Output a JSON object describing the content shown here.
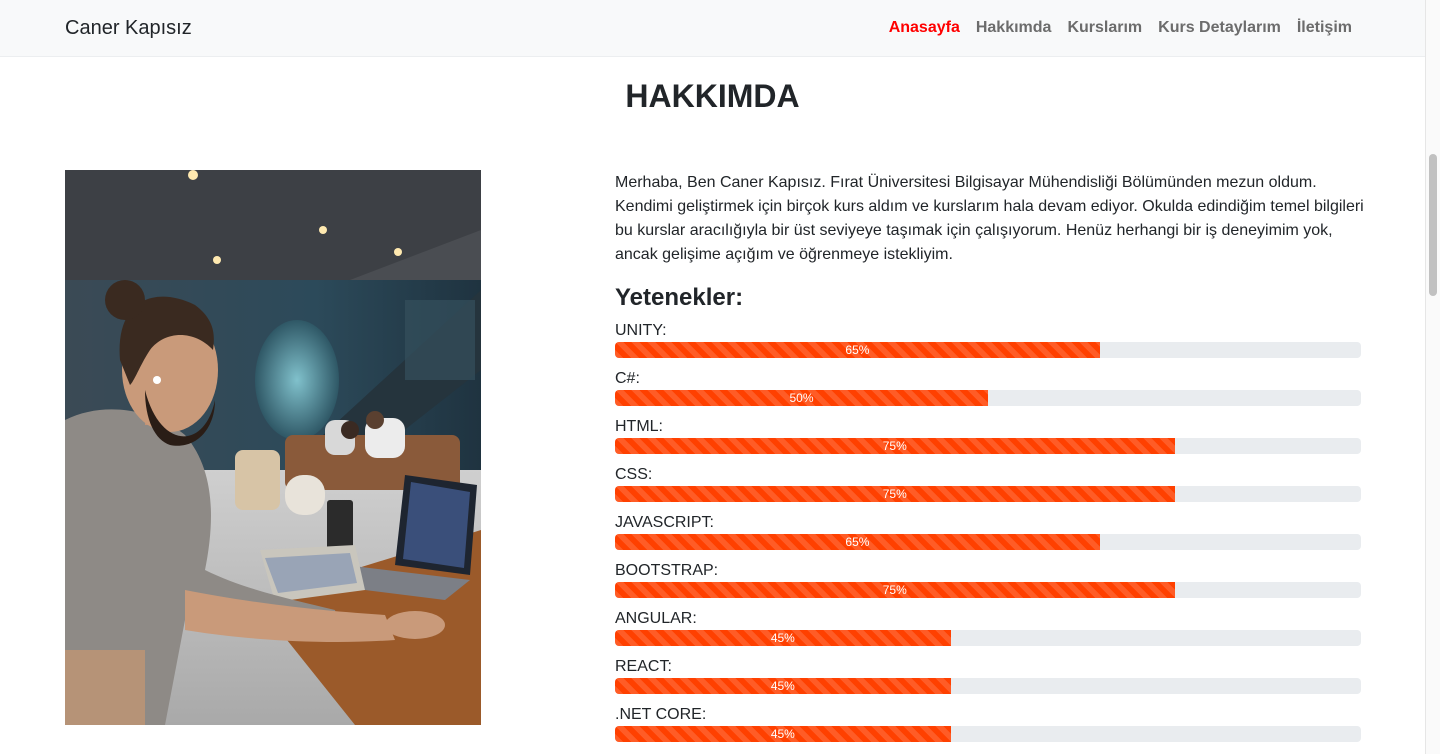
{
  "navbar": {
    "brand": "Caner Kapısız",
    "links": [
      {
        "label": "Anasayfa",
        "active": true
      },
      {
        "label": "Hakkımda",
        "active": false
      },
      {
        "label": "Kurslarım",
        "active": false
      },
      {
        "label": "Kurs Detaylarım",
        "active": false
      },
      {
        "label": "İletişim",
        "active": false
      }
    ],
    "active_color": "#ff0000",
    "link_color": "#6c6c6c"
  },
  "about": {
    "title": "HAKKIMDA",
    "text": "Merhaba, Ben Caner Kapısız. Fırat Üniversitesi Bilgisayar Mühendisliği Bölümünden mezun oldum. Kendimi geliştirmek için birçok kurs aldım ve kurslarım hala devam ediyor. Okulda edindiğim temel bilgileri bu kurslar aracılığıyla bir üst seviyeye taşımak için çalışıyorum. Henüz herhangi bir iş deneyimim yok, ancak gelişime açığım ve öğrenmeye istekliyim."
  },
  "skills": {
    "title": "Yetenekler:",
    "bar_color": "#ff4000",
    "items": [
      {
        "label": "UNITY:",
        "percent": 65,
        "text": "65%"
      },
      {
        "label": "C#:",
        "percent": 50,
        "text": "50%"
      },
      {
        "label": "HTML:",
        "percent": 75,
        "text": "75%"
      },
      {
        "label": "CSS:",
        "percent": 75,
        "text": "75%"
      },
      {
        "label": "JAVASCRIPT:",
        "percent": 65,
        "text": "65%"
      },
      {
        "label": "BOOTSTRAP:",
        "percent": 75,
        "text": "75%"
      },
      {
        "label": "ANGULAR:",
        "percent": 45,
        "text": "45%"
      },
      {
        "label": "REACT:",
        "percent": 45,
        "text": "45%"
      },
      {
        "label": ".NET CORE:",
        "percent": 45,
        "text": "45%"
      }
    ]
  }
}
